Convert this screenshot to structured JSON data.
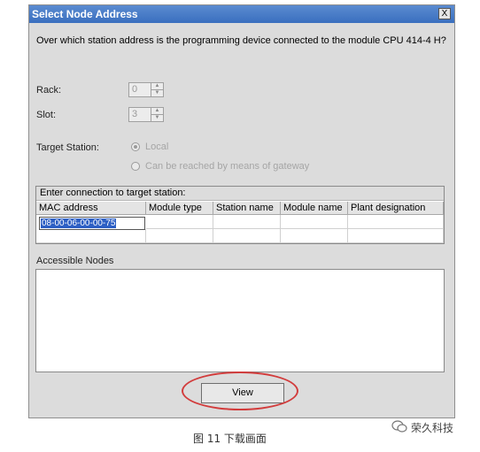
{
  "dialog": {
    "title": "Select Node Address",
    "close_label": "X",
    "question": "Over which station address is the programming device connected to the module CPU 414-4 H?",
    "rack": {
      "label": "Rack:",
      "value": "0"
    },
    "slot": {
      "label": "Slot:",
      "value": "3"
    },
    "target_station": {
      "label": "Target Station:",
      "options": [
        "Local",
        "Can be reached by means of gateway"
      ],
      "selected": "Local"
    },
    "connection": {
      "header": "Enter connection to target station:",
      "columns": [
        "MAC address",
        "Module type",
        "Station name",
        "Module name",
        "Plant designation"
      ],
      "mac_value": "08-00-06-00-00-75"
    },
    "accessible_nodes_label": "Accessible Nodes",
    "view_button": "View"
  },
  "caption": "图 11   下载画面",
  "watermark": "荣久科技",
  "colors": {
    "titlebar": "#3a6fbf",
    "highlight": "#d23c3c",
    "selection": "#2d5fc4"
  }
}
